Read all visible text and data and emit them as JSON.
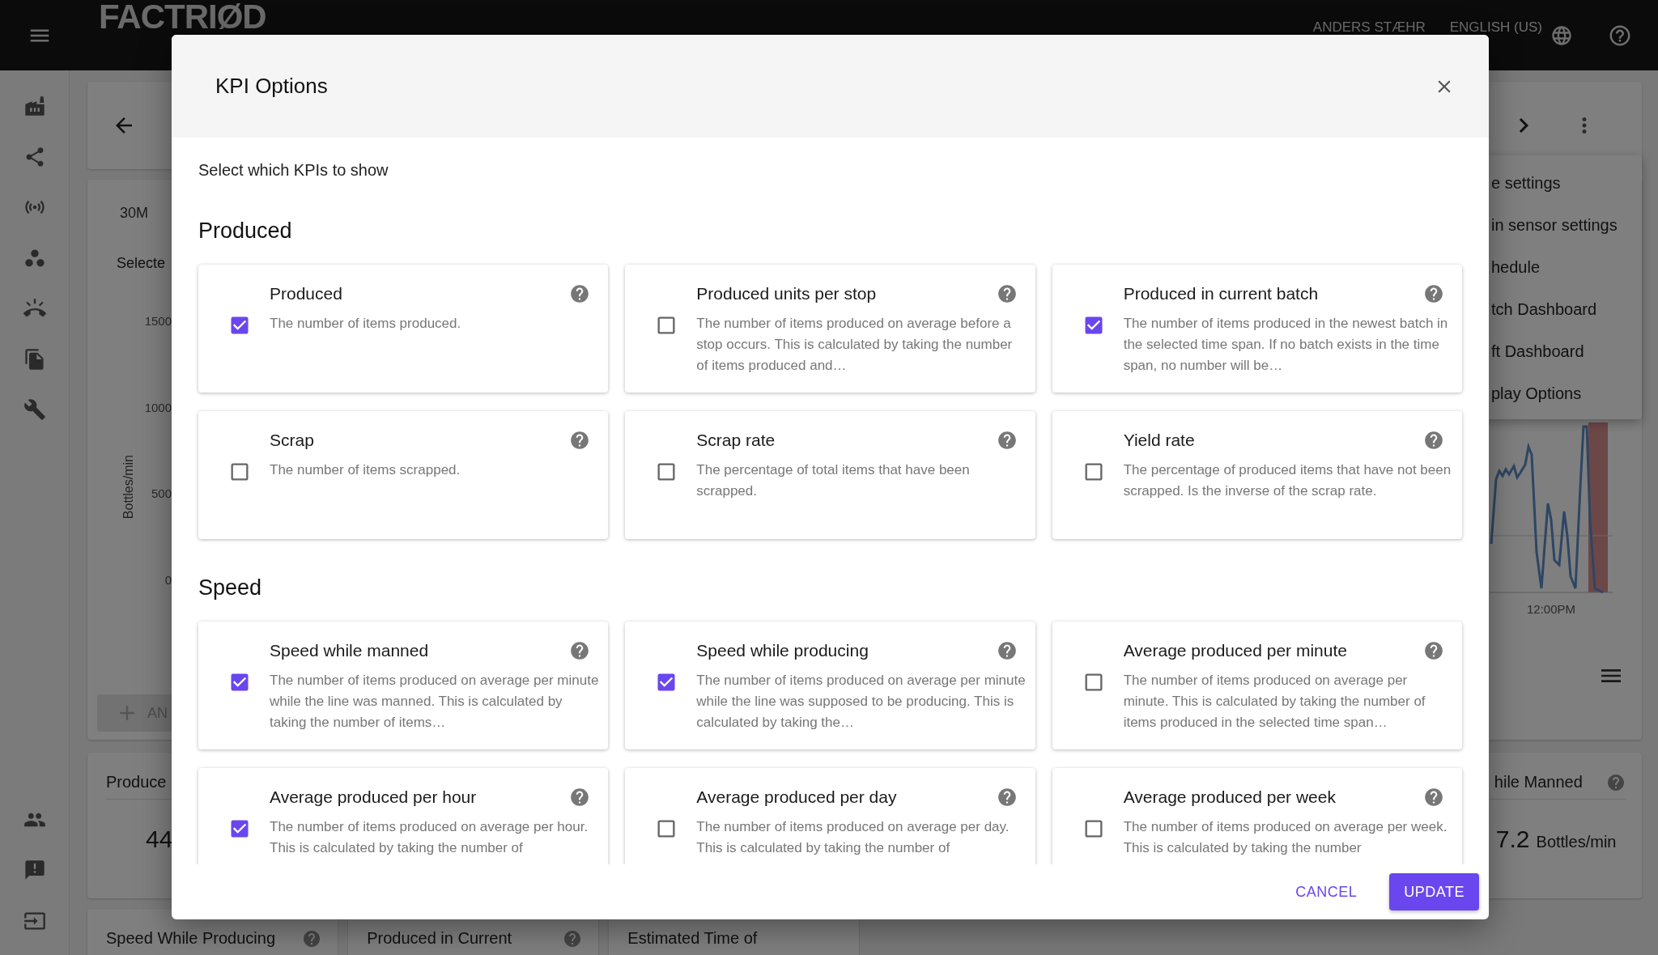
{
  "top_bar": {
    "logo": "FACTRIØD",
    "user": "ANDERS STÆHR",
    "language": "ENGLISH (US)"
  },
  "chart_card": {
    "range": "30M",
    "selection": "Selecte",
    "y_axis_label": "Bottles/min",
    "y_ticks": [
      "1500",
      "1000",
      "500",
      "0"
    ],
    "x_tick": "12:00PM",
    "add_button": "AN"
  },
  "menu": {
    "items": [
      "e settings",
      "in sensor settings",
      "hedule",
      "tch Dashboard",
      "ft Dashboard",
      "play Options"
    ]
  },
  "kpi_left": {
    "title": "Produce",
    "value": "44"
  },
  "kpi_right": {
    "title": "hile Manned",
    "value": "7.2",
    "unit": "Bottles/min"
  },
  "bottom_cards": [
    {
      "title": "Speed While Producing",
      "help": true
    },
    {
      "title": "Produced in Current",
      "help": true
    },
    {
      "title": "Estimated Time of",
      "help": false
    }
  ],
  "dialog": {
    "title": "KPI Options",
    "intro": "Select which KPIs to show",
    "sections": [
      {
        "heading": "Produced",
        "options": [
          {
            "title": "Produced",
            "description": "The number of items produced.",
            "checked": true
          },
          {
            "title": "Produced units per stop",
            "description": "The number of items produced on average before a stop occurs. This is calculated by taking the number of items produced and…",
            "checked": false
          },
          {
            "title": "Produced in current batch",
            "description": "The number of items produced in the newest batch in the selected time span. If no batch exists in the time span, no number will be…",
            "checked": true
          },
          {
            "title": "Scrap",
            "description": "The number of items scrapped.",
            "checked": false
          },
          {
            "title": "Scrap rate",
            "description": "The percentage of total items that have been scrapped.",
            "checked": false
          },
          {
            "title": "Yield rate",
            "description": "The percentage of produced items that have not been scrapped. Is the inverse of the scrap rate.",
            "checked": false
          }
        ]
      },
      {
        "heading": "Speed",
        "options": [
          {
            "title": "Speed while manned",
            "description": "The number of items produced on average per minute while the line was manned. This is calculated by taking the number of items…",
            "checked": true
          },
          {
            "title": "Speed while producing",
            "description": "The number of items produced on average per minute while the line was supposed to be producing. This is calculated by taking the…",
            "checked": true
          },
          {
            "title": "Average produced per minute",
            "description": "The number of items produced on average per minute. This is calculated by taking the number of items produced in the selected time span…",
            "checked": false
          },
          {
            "title": "Average produced per hour",
            "description": "The number of items produced on average per hour. This is calculated by taking the number of",
            "checked": true
          },
          {
            "title": "Average produced per day",
            "description": "The number of items produced on average per day. This is calculated by taking the number of",
            "checked": false
          },
          {
            "title": "Average produced per week",
            "description": "The number of items produced on average per week. This is calculated by taking the number",
            "checked": false
          }
        ]
      }
    ],
    "buttons": [
      {
        "label": "CANCEL",
        "kind": "text"
      },
      {
        "label": "UPDATE",
        "kind": "contained"
      }
    ]
  }
}
